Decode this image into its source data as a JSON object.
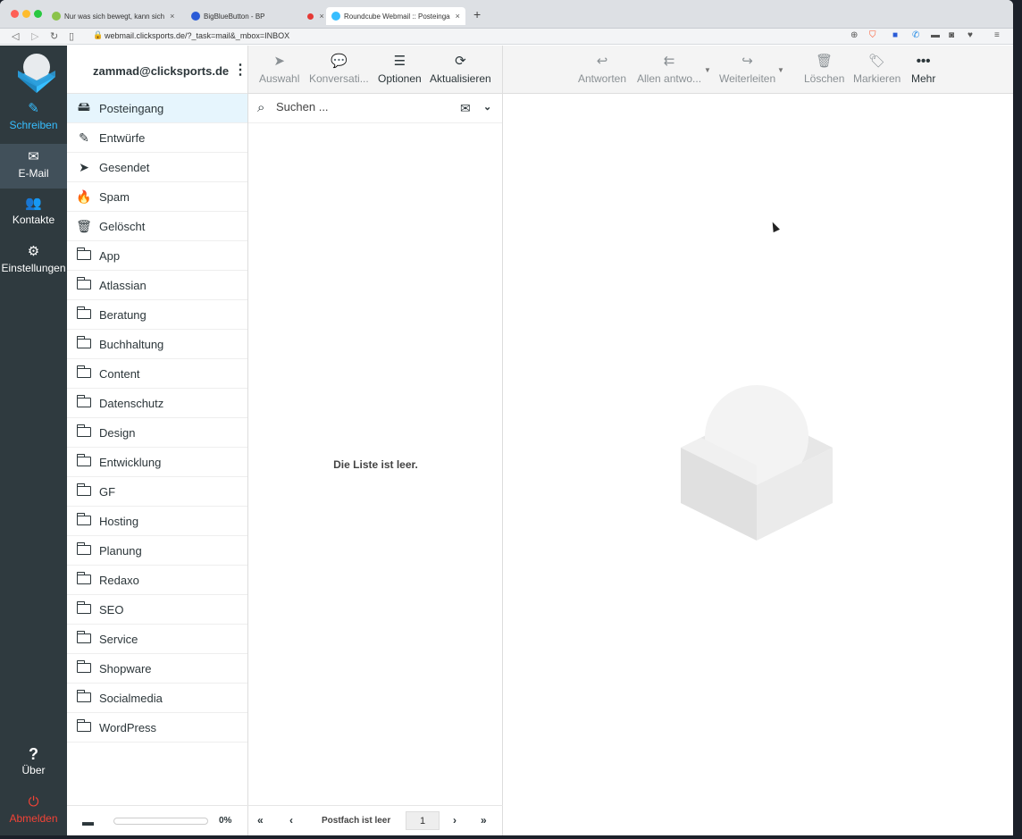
{
  "browser": {
    "tabs": [
      {
        "title": "Nur was sich bewegt, kann sich",
        "close": "×"
      },
      {
        "title": "BigBlueButton - BP",
        "close": "×"
      },
      {
        "title": "Roundcube Webmail :: Posteinga",
        "close": "×"
      }
    ],
    "new_tab": "+",
    "url": "webmail.clicksports.de/?_task=mail&_mbox=INBOX"
  },
  "taskmenu": {
    "compose": "Schreiben",
    "mail": "E-Mail",
    "contacts": "Kontakte",
    "settings": "Einstellungen",
    "about": "Über",
    "logout": "Abmelden"
  },
  "account": "zammad@clicksports.de",
  "folders": [
    {
      "label": "Posteingang",
      "icon": "inbox-icon",
      "selected": true
    },
    {
      "label": "Entwürfe",
      "icon": "pencil-icon"
    },
    {
      "label": "Gesendet",
      "icon": "paper-plane-icon"
    },
    {
      "label": "Spam",
      "icon": "fire-icon"
    },
    {
      "label": "Gelöscht",
      "icon": "trash-icon"
    },
    {
      "label": "App",
      "icon": "folder-icon"
    },
    {
      "label": "Atlassian",
      "icon": "folder-icon"
    },
    {
      "label": "Beratung",
      "icon": "folder-icon"
    },
    {
      "label": "Buchhaltung",
      "icon": "folder-icon"
    },
    {
      "label": "Content",
      "icon": "folder-icon"
    },
    {
      "label": "Datenschutz",
      "icon": "folder-icon"
    },
    {
      "label": "Design",
      "icon": "folder-icon"
    },
    {
      "label": "Entwicklung",
      "icon": "folder-icon"
    },
    {
      "label": "GF",
      "icon": "folder-icon"
    },
    {
      "label": "Hosting",
      "icon": "folder-icon"
    },
    {
      "label": "Planung",
      "icon": "folder-icon"
    },
    {
      "label": "Redaxo",
      "icon": "folder-icon"
    },
    {
      "label": "SEO",
      "icon": "folder-icon"
    },
    {
      "label": "Service",
      "icon": "folder-icon"
    },
    {
      "label": "Shopware",
      "icon": "folder-icon"
    },
    {
      "label": "Socialmedia",
      "icon": "folder-icon"
    },
    {
      "label": "WordPress",
      "icon": "folder-icon"
    }
  ],
  "quota": {
    "text": "0%",
    "used_fraction": 0
  },
  "list_toolbar": {
    "select": "Auswahl",
    "threads": "Konversati...",
    "options": "Optionen",
    "refresh": "Aktualisieren"
  },
  "search": {
    "placeholder": "Suchen ..."
  },
  "list_empty": "Die Liste ist leer.",
  "pagination": {
    "status": "Postfach ist leer",
    "page": "1"
  },
  "message_toolbar": {
    "reply": "Antworten",
    "reply_all": "Allen antwo...",
    "forward": "Weiterleiten",
    "delete": "Löschen",
    "mark": "Markieren",
    "more": "Mehr"
  },
  "colors": {
    "accent": "#37beff",
    "sidebar": "#2f3a3f",
    "logout": "#f44336",
    "selected_folder": "#e6f5fd"
  }
}
